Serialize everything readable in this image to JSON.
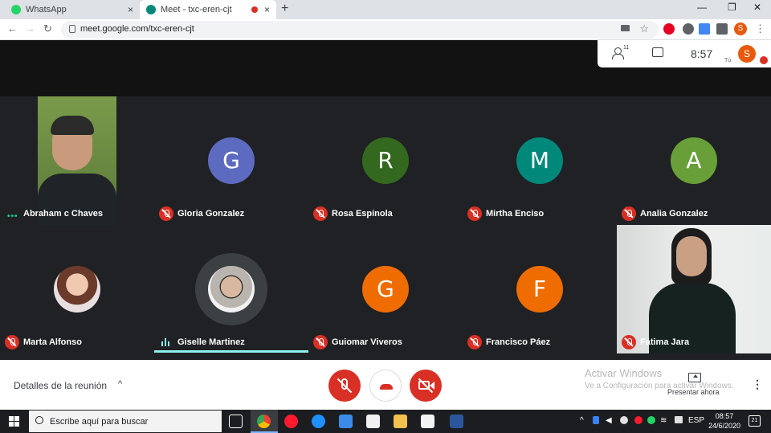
{
  "browser": {
    "tabs": [
      {
        "title": "WhatsApp",
        "close": "×"
      },
      {
        "title": "Meet - txc-eren-cjt",
        "close": "×"
      }
    ],
    "new_tab": "+",
    "window_controls": {
      "minimize": "—",
      "maximize": "❐",
      "close": "✕"
    },
    "nav": {
      "back": "←",
      "forward": "→",
      "reload": "↻"
    },
    "url": "meet.google.com/txc-eren-cjt",
    "star": "☆",
    "menu": "⋮",
    "profile_initial": "S"
  },
  "meet": {
    "participants_count": "11",
    "clock": "8:57",
    "self_label": "Tú",
    "self_initial": "S",
    "tiles": [
      {
        "name": "Abraham c Chaves",
        "type": "video",
        "status": "speaking-dots"
      },
      {
        "name": "Gloria Gonzalez",
        "initial": "G",
        "color": "#5c6bc0",
        "muted": true
      },
      {
        "name": "Rosa Espinola",
        "initial": "R",
        "color": "#33691e",
        "muted": true
      },
      {
        "name": "Mirtha Enciso",
        "initial": "M",
        "color": "#00897b",
        "muted": true
      },
      {
        "name": "Analia Gonzalez",
        "initial": "A",
        "color": "#689f38",
        "muted": true
      },
      {
        "name": "Marta Alfonso",
        "type": "photo",
        "muted": true
      },
      {
        "name": "Giselle Martinez",
        "type": "photo",
        "status": "talking"
      },
      {
        "name": "Guiomar Viveros",
        "initial": "G",
        "color": "#ef6c00",
        "muted": true
      },
      {
        "name": "Francisco Páez",
        "initial": "F",
        "color": "#ef6c00",
        "muted": true
      },
      {
        "name": "Fátima Jara",
        "type": "video",
        "muted": true
      }
    ],
    "bottom": {
      "details_label": "Detalles de la reunión",
      "details_caret": "^",
      "present_label": "Presentar ahora",
      "menu": "⋮"
    },
    "watermark": {
      "line1": "Activar Windows",
      "line2": "Ve a Configuración para activar Windows."
    }
  },
  "taskbar": {
    "search_placeholder": "Escribe aquí para buscar",
    "language": "ESP",
    "time": "08:57",
    "date": "24/6/2020",
    "notifications": "21",
    "tray_arrow": "^"
  },
  "colors": {
    "accent_red": "#d93025",
    "talk_teal": "#8ef1ec"
  }
}
